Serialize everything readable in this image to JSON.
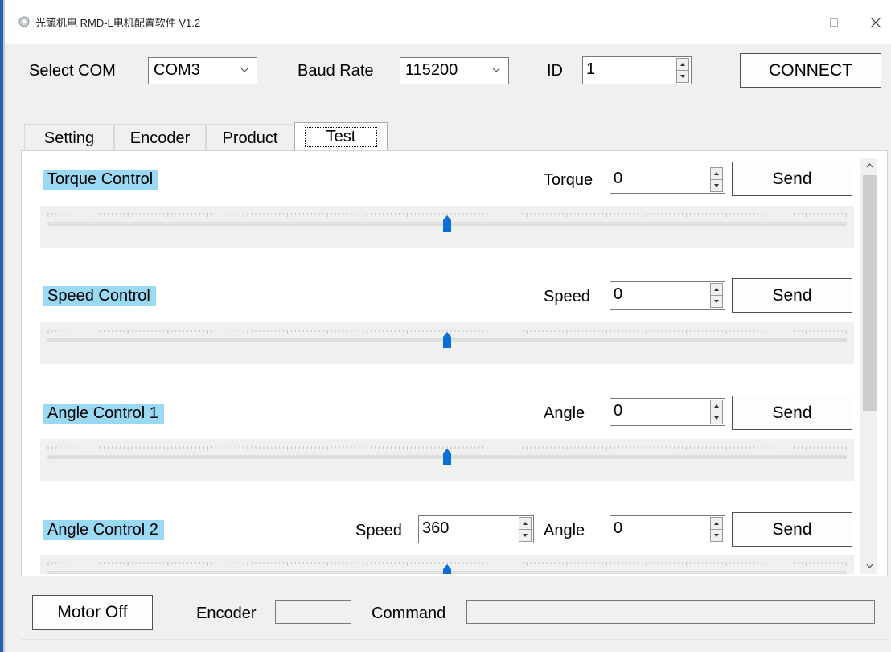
{
  "window": {
    "title": "光毓机电 RMD-L电机配置软件 V1.2",
    "controls": {
      "minimize": "—",
      "maximize": "□",
      "close": "✕"
    }
  },
  "connection": {
    "com_label": "Select COM",
    "com_value": "COM3",
    "baud_label": "Baud Rate",
    "baud_value": "115200",
    "id_label": "ID",
    "id_value": "1",
    "connect_label": "CONNECT"
  },
  "tabs": [
    {
      "label": "Setting"
    },
    {
      "label": "Encoder"
    },
    {
      "label": "Product"
    },
    {
      "label": "Test"
    }
  ],
  "active_tab": "Test",
  "test": {
    "torque": {
      "title": "Torque Control",
      "field_label": "Torque",
      "value": "0",
      "send_label": "Send",
      "slider_fraction": 0.5
    },
    "speed": {
      "title": "Speed Control",
      "field_label": "Speed",
      "value": "0",
      "send_label": "Send",
      "slider_fraction": 0.5
    },
    "angle1": {
      "title": "Angle Control 1",
      "field_label": "Angle",
      "value": "0",
      "send_label": "Send",
      "slider_fraction": 0.5
    },
    "angle2": {
      "title": "Angle Control 2",
      "speed_label": "Speed",
      "speed_value": "360",
      "field_label": "Angle",
      "value": "0",
      "send_label": "Send",
      "slider_fraction": 0.5
    }
  },
  "footer": {
    "motor_off_label": "Motor Off",
    "encoder_label": "Encoder",
    "encoder_value": "",
    "command_label": "Command",
    "command_value": ""
  },
  "colors": {
    "section_highlight": "#99d9f4",
    "slider_thumb": "#0a6fd6",
    "window_accent": "#1f63b8"
  }
}
